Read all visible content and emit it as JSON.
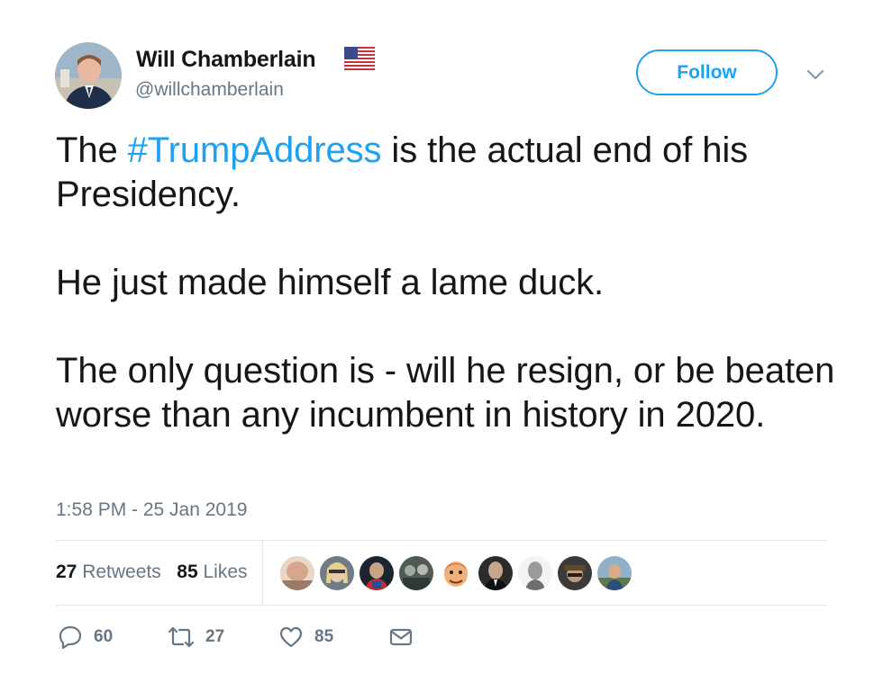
{
  "author": {
    "name": "Will Chamberlain",
    "handle": "@willchamberlain",
    "flag_icon": "us-flag-icon"
  },
  "follow_label": "Follow",
  "text": {
    "line1_before": "The ",
    "hashtag": "#TrumpAddress",
    "line1_after": " is the actual end of his Presidency.",
    "paragraph2": "He just made himself a lame duck.",
    "paragraph3": "The only question is - will he resign, or be beaten worse than any incumbent in history in 2020."
  },
  "timestamp": "1:58 PM - 25 Jan 2019",
  "stats": {
    "retweets_count": "27",
    "retweets_label": "Retweets",
    "likes_count": "85",
    "likes_label": "Likes"
  },
  "actions": {
    "reply_count": "60",
    "retweet_count": "27",
    "like_count": "85"
  },
  "colors": {
    "accent": "#1da1f2",
    "text": "#14171a",
    "muted": "#657786",
    "divider": "#e1e8ed"
  }
}
